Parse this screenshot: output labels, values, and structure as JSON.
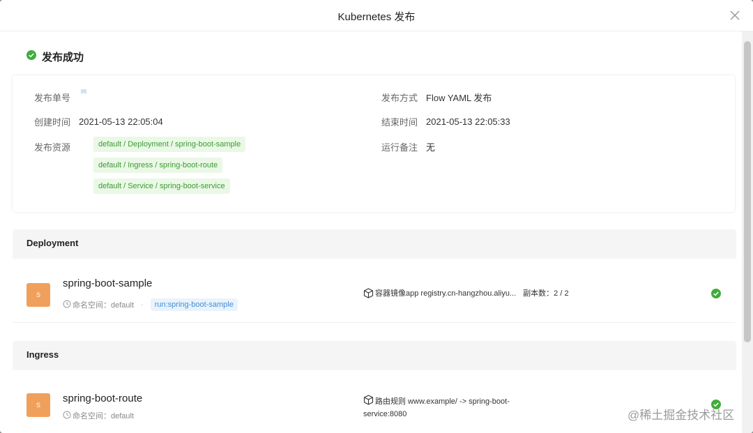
{
  "modal": {
    "title": "Kubernetes 发布"
  },
  "status": {
    "text": "发布成功",
    "color": "#3fae3a"
  },
  "info": {
    "release_no_label": "发布单号",
    "created_label": "创建时间",
    "created_value": "2021-05-13 22:05:04",
    "resources_label": "发布资源",
    "resources": [
      "default / Deployment / spring-boot-sample",
      "default / Ingress / spring-boot-route",
      "default / Service / spring-boot-service"
    ],
    "method_label": "发布方式",
    "method_value": "Flow YAML 发布",
    "end_label": "结束时间",
    "end_value": "2021-05-13 22:05:33",
    "remark_label": "运行备注",
    "remark_value": "无"
  },
  "deployment": {
    "title": "Deployment",
    "icon_text": "S",
    "name": "spring-boot-sample",
    "namespace": "命名空间：default",
    "label": "run:spring-boot-sample",
    "image": "容器镜像app registry.cn-hangzhou.aliyu...",
    "replicas": "副本数：2 / 2"
  },
  "ingress": {
    "title": "Ingress",
    "icon_text": "S",
    "name": "spring-boot-route",
    "namespace": "命名空间：default",
    "rule_line1": "路由规则 www.example/ -> spring-boot-",
    "rule_line2": "service:8080"
  },
  "watermark": "@稀土掘金技术社区"
}
